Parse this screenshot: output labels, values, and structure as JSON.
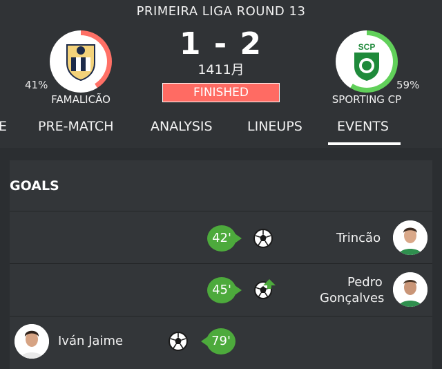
{
  "match": {
    "competition": "PRIMEIRA LIGA ROUND 13",
    "score": "1 - 2",
    "date": "1411月",
    "status": "FINISHED"
  },
  "home": {
    "name": "FAMALICÃO",
    "possession": "41%",
    "crest_text": "FCF",
    "ring_color": "#ff7066"
  },
  "away": {
    "name": "SPORTING CP",
    "possession": "59%",
    "crest_text": "SCP",
    "ring_color": "#61d05a"
  },
  "tabs": [
    {
      "label": "E"
    },
    {
      "label": "PRE-MATCH"
    },
    {
      "label": "ANALYSIS"
    },
    {
      "label": "LINEUPS"
    },
    {
      "label": "EVENTS",
      "active": true
    }
  ],
  "goals": {
    "title": "GOALS",
    "events": [
      {
        "minute": "42'",
        "player": "Trincão",
        "side": "away",
        "assist": false
      },
      {
        "minute": "45'",
        "player_line1": "Pedro",
        "player_line2": "Gonçalves",
        "side": "away",
        "assist": true
      },
      {
        "minute": "79'",
        "player": "Iván Jaime",
        "side": "home",
        "assist": false
      }
    ]
  },
  "colors": {
    "background": "#2b2e31",
    "header": "#303336",
    "card": "#333639",
    "minute_badge": "#4daa3c",
    "finished": "#ff6b63"
  }
}
